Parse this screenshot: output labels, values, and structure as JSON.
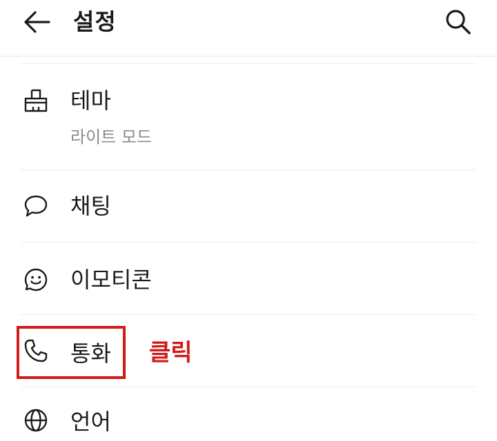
{
  "header": {
    "back_icon": "arrow-left-icon",
    "title": "설정",
    "search_icon": "search-icon"
  },
  "settings": [
    {
      "label": "테마",
      "sublabel": "라이트 모드",
      "icon": "paint-brush-icon"
    },
    {
      "label": "채팅",
      "icon": "chat-bubble-icon"
    },
    {
      "label": "이모티콘",
      "icon": "smiley-icon"
    },
    {
      "label": "통화",
      "icon": "phone-icon"
    },
    {
      "label": "언어",
      "icon": "globe-icon"
    }
  ],
  "annotation": {
    "text": "클릭",
    "color": "#d11a1a"
  }
}
